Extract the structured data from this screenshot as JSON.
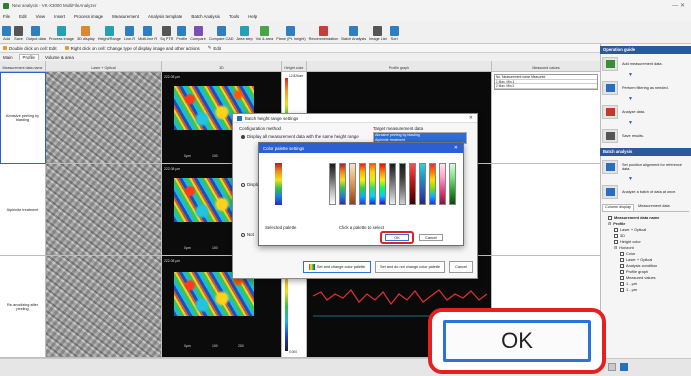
{
  "window": {
    "title": "New analysis - VK-X3000 MultiFileAnalyzer",
    "controls": "—   ✕"
  },
  "menu": [
    "File",
    "Edit",
    "View",
    "Insert",
    "Process image",
    "Measurement",
    "Analysis template",
    "Batch Analysis",
    "Tools",
    "Help"
  ],
  "ribbon": [
    "Add",
    "Save",
    "Output data",
    "Process image",
    "3D display",
    "Height/Range",
    "Line-R",
    "Multi-line R",
    "Sq PTR",
    "Profile",
    "Compare",
    "Compare CAD",
    "Area step",
    "Vol & area",
    "Plane (Pt. height)",
    "Recommendation",
    "Batch Analysis",
    "Image List",
    "Sort"
  ],
  "hints": {
    "double_click": "Double click on cell: Edit",
    "right_click": "Right click on cell: Change type of display image and other actions",
    "edit": "Edit"
  },
  "tabs": [
    "Main",
    "Profile",
    "Volume & area"
  ],
  "grid": {
    "columns": [
      "Measurement data name",
      "Laser + Optical",
      "3D",
      "Height color",
      "Profile graph",
      "Measured values"
    ],
    "col_letters": [
      "A",
      "B",
      "C",
      "D",
      "E"
    ],
    "group_profile": "Profile",
    "group_horizon": "Horizont",
    "rows": [
      {
        "num": "1",
        "name": "Abrasive peeling by blasting",
        "scale": "222.08 μm",
        "scale_top": "222.08 μm",
        "x_lbl": "0μm",
        "x_mid": "100",
        "x_end": "200"
      },
      {
        "num": "2",
        "name": "Alphinite treatment",
        "scale": "222.08 μm",
        "scale_top": "222.08 μm",
        "x_lbl": "0μm",
        "x_mid": "100",
        "x_end": "200"
      },
      {
        "num": "3",
        "name": "Re-anodizing after peeling",
        "scale": "222.08 μm",
        "scale_top": "222.08 μm",
        "x_lbl": "0μm",
        "x_mid": "100",
        "x_end": "200"
      }
    ],
    "height_top": "12.826um",
    "height_bottom": "0.000",
    "mv_rows": [
      "No.  Measurement name  Measured",
      "1    Max. Min.1",
      "2    Max. Min.2"
    ],
    "scale_right": "250.000μm"
  },
  "right_panel": {
    "operation_guide_title": "Operation guide",
    "steps": [
      "Add measurement data.",
      "Perform filtering as needed.",
      "Analyze data.",
      "Save results."
    ],
    "batch_title": "Batch analysis",
    "batch_steps": [
      "Set position alignment for reference data.",
      "Analyze a batch of data at once."
    ],
    "tabs": [
      "Column display",
      "Measurement data"
    ],
    "tree": [
      {
        "label": "Measurement data name",
        "level": 0
      },
      {
        "label": "Profile",
        "level": 0
      },
      {
        "label": "Laser + Optical",
        "level": 1
      },
      {
        "label": "3D",
        "level": 1
      },
      {
        "label": "Height color",
        "level": 1
      },
      {
        "label": "Horizont",
        "level": 1
      },
      {
        "label": "Color",
        "level": 2
      },
      {
        "label": "Laser + Optical",
        "level": 2
      },
      {
        "label": "Analysis condition",
        "level": 2
      },
      {
        "label": "Profile graph",
        "level": 2
      },
      {
        "label": "Measured values",
        "level": 2
      },
      {
        "label": "1 - μm",
        "level": 2
      },
      {
        "label": "1 - μm",
        "level": 2
      }
    ]
  },
  "batch_dialog": {
    "title": "Batch height range settings",
    "config_label": "Configuration method",
    "option1": "Display all measurement data with the same height range",
    "option2": "Display",
    "option3": "Not",
    "target_label": "Target measurement data",
    "target_items": [
      "Abrasive peeling by blasting",
      "Alphinite treatment"
    ],
    "btn_set_change": "Set and change color palette",
    "btn_set_nochange": "Set and do not change color palette",
    "btn_cancel": "Cancel"
  },
  "palette_dialog": {
    "title": "Color palette settings",
    "selected_label": "Selected palette",
    "click_label": "Click a palette to select",
    "ok": "OK",
    "cancel": "Cancel",
    "palettes": [
      [
        "#1a1a1a",
        "#606060",
        "#b8b8b8",
        "#ffffff"
      ],
      [
        "#c2142c",
        "#f08a1c",
        "#f2e21e",
        "#3bbf4a",
        "#1c82d6",
        "#2a2ab8"
      ],
      [
        "#f5e6c8",
        "#e8b27a",
        "#c7783c",
        "#8a4218"
      ],
      [
        "#ff1e00",
        "#ffb400",
        "#f5f500",
        "#31d631",
        "#00b4ff",
        "#1c3cff"
      ],
      [
        "#ff5a00",
        "#ffd400",
        "#e0f000",
        "#30e060",
        "#00d8ff",
        "#0030ff"
      ],
      [
        "#ff0000",
        "#ff8800",
        "#ffee00",
        "#00ff55",
        "#00ccff",
        "#3300ff"
      ],
      [
        "#1a1a1a",
        "#5a5a5a",
        "#a0a0a0",
        "#eaeaea"
      ],
      [
        "#1c1c1c",
        "#3c3c3c",
        "#7c7c7c",
        "#d0d0d0"
      ],
      [
        "#ff4d4d",
        "#d12020",
        "#8a0a0a",
        "#3a0000"
      ],
      [
        "#2cd1e6",
        "#1c98c8",
        "#2c5bb8",
        "#1c2a8a"
      ],
      [
        "#ff2828",
        "#ff7a00",
        "#ffdc00",
        "#84e000",
        "#00b8ff",
        "#1e2eff"
      ],
      [
        "#ffe6f2",
        "#ff9ec9",
        "#e2407e",
        "#8c0f3c"
      ],
      [
        "#d6ffd6",
        "#84e084",
        "#2c9e2c",
        "#0a4a0a"
      ]
    ],
    "selected_palette": [
      "#c2142c",
      "#f08a1c",
      "#f2e21e",
      "#3bbf4a",
      "#1c82d6",
      "#2a2ab8"
    ]
  },
  "callout": {
    "label": "OK"
  }
}
